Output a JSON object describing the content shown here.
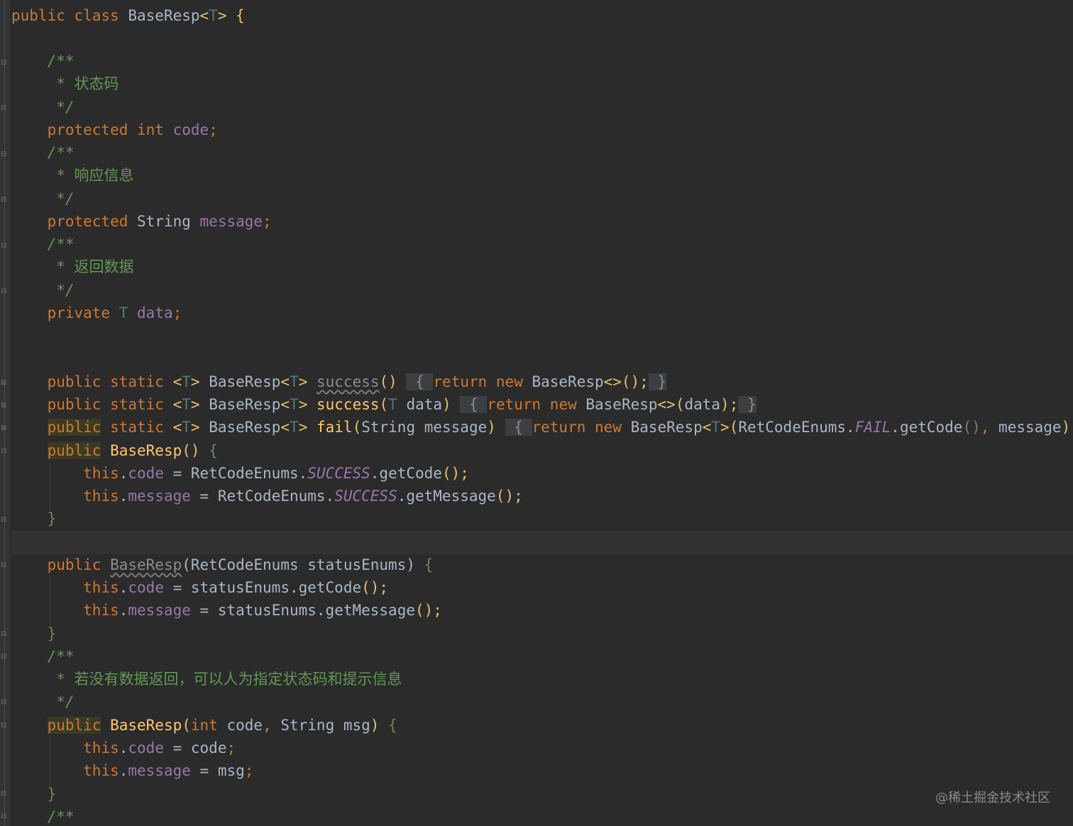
{
  "code_lines": [
    {
      "text": "public class BaseResp<T> {"
    },
    {
      "text": ""
    },
    {
      "text": "    /**"
    },
    {
      "text": "     * 状态码"
    },
    {
      "text": "     */"
    },
    {
      "text": "    protected int code;"
    },
    {
      "text": "    /**"
    },
    {
      "text": "     * 响应信息"
    },
    {
      "text": "     */"
    },
    {
      "text": "    protected String message;"
    },
    {
      "text": "    /**"
    },
    {
      "text": "     * 返回数据"
    },
    {
      "text": "     */"
    },
    {
      "text": "    private T data;"
    },
    {
      "text": ""
    },
    {
      "text": ""
    },
    {
      "text": "    public static <T> BaseResp<T> success() { return new BaseResp<>(); }"
    },
    {
      "text": "    public static <T> BaseResp<T> success(T data) { return new BaseResp<>(data); }"
    },
    {
      "text": "    public static <T> BaseResp<T> fail(String message) { return new BaseResp<T>(RetCodeEnums.FAIL.getCode(), message);"
    },
    {
      "text": "    public BaseResp() {"
    },
    {
      "text": "        this.code = RetCodeEnums.SUCCESS.getCode();"
    },
    {
      "text": "        this.message = RetCodeEnums.SUCCESS.getMessage();"
    },
    {
      "text": "    }"
    },
    {
      "text": ""
    },
    {
      "text": "    public BaseResp(RetCodeEnums statusEnums) {"
    },
    {
      "text": "        this.code = statusEnums.getCode();"
    },
    {
      "text": "        this.message = statusEnums.getMessage();"
    },
    {
      "text": "    }"
    },
    {
      "text": "    /**"
    },
    {
      "text": "     * 若没有数据返回，可以人为指定状态码和提示信息"
    },
    {
      "text": "     */"
    },
    {
      "text": "    public BaseResp(int code, String msg) {"
    },
    {
      "text": "        this.code = code;"
    },
    {
      "text": "        this.message = msg;"
    },
    {
      "text": "    }"
    },
    {
      "text": "    /**"
    }
  ],
  "comments": {
    "status_code": "状态码",
    "response_message": "响应信息",
    "return_data": "返回数据",
    "manual_specify": "若没有数据返回，可以人为指定状态码和提示信息"
  },
  "watermark": "@稀土掘金技术社区",
  "colors": {
    "background": "#2b2b2b",
    "keyword": "#cc7832",
    "type_param": "#507874",
    "field": "#9876aa",
    "method": "#ffc66d",
    "comment": "#629755",
    "text": "#a9b7c6"
  }
}
